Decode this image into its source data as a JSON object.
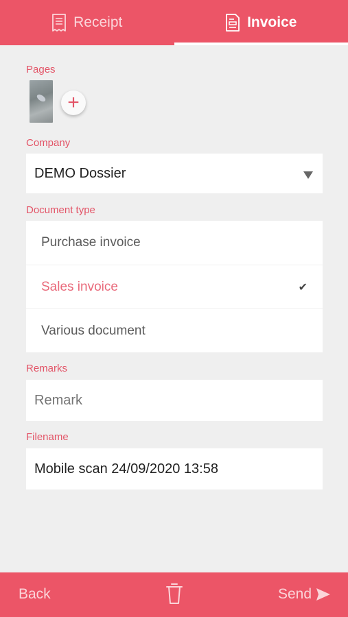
{
  "tabs": [
    {
      "label": "Receipt",
      "icon": "receipt-icon",
      "active": false
    },
    {
      "label": "Invoice",
      "icon": "invoice-icon",
      "active": true
    }
  ],
  "pages": {
    "label": "Pages",
    "add_icon": "plus-icon"
  },
  "company": {
    "label": "Company",
    "value": "DEMO Dossier",
    "icon": "dropdown-caret-icon"
  },
  "document_type": {
    "label": "Document type",
    "options": [
      {
        "label": "Purchase invoice",
        "selected": false
      },
      {
        "label": "Sales invoice",
        "selected": true
      },
      {
        "label": "Various document",
        "selected": false
      }
    ],
    "check_icon": "checkmark-icon"
  },
  "remarks": {
    "label": "Remarks",
    "placeholder": "Remark",
    "value": ""
  },
  "filename": {
    "label": "Filename",
    "value": "Mobile scan 24/09/2020 13:58"
  },
  "bottom_bar": {
    "back_label": "Back",
    "trash_icon": "trash-icon",
    "send_label": "Send",
    "send_icon": "send-icon"
  },
  "colors": {
    "accent": "#ec5567",
    "label": "#e35467",
    "selected": "#e96a7b",
    "background": "#efefef"
  }
}
